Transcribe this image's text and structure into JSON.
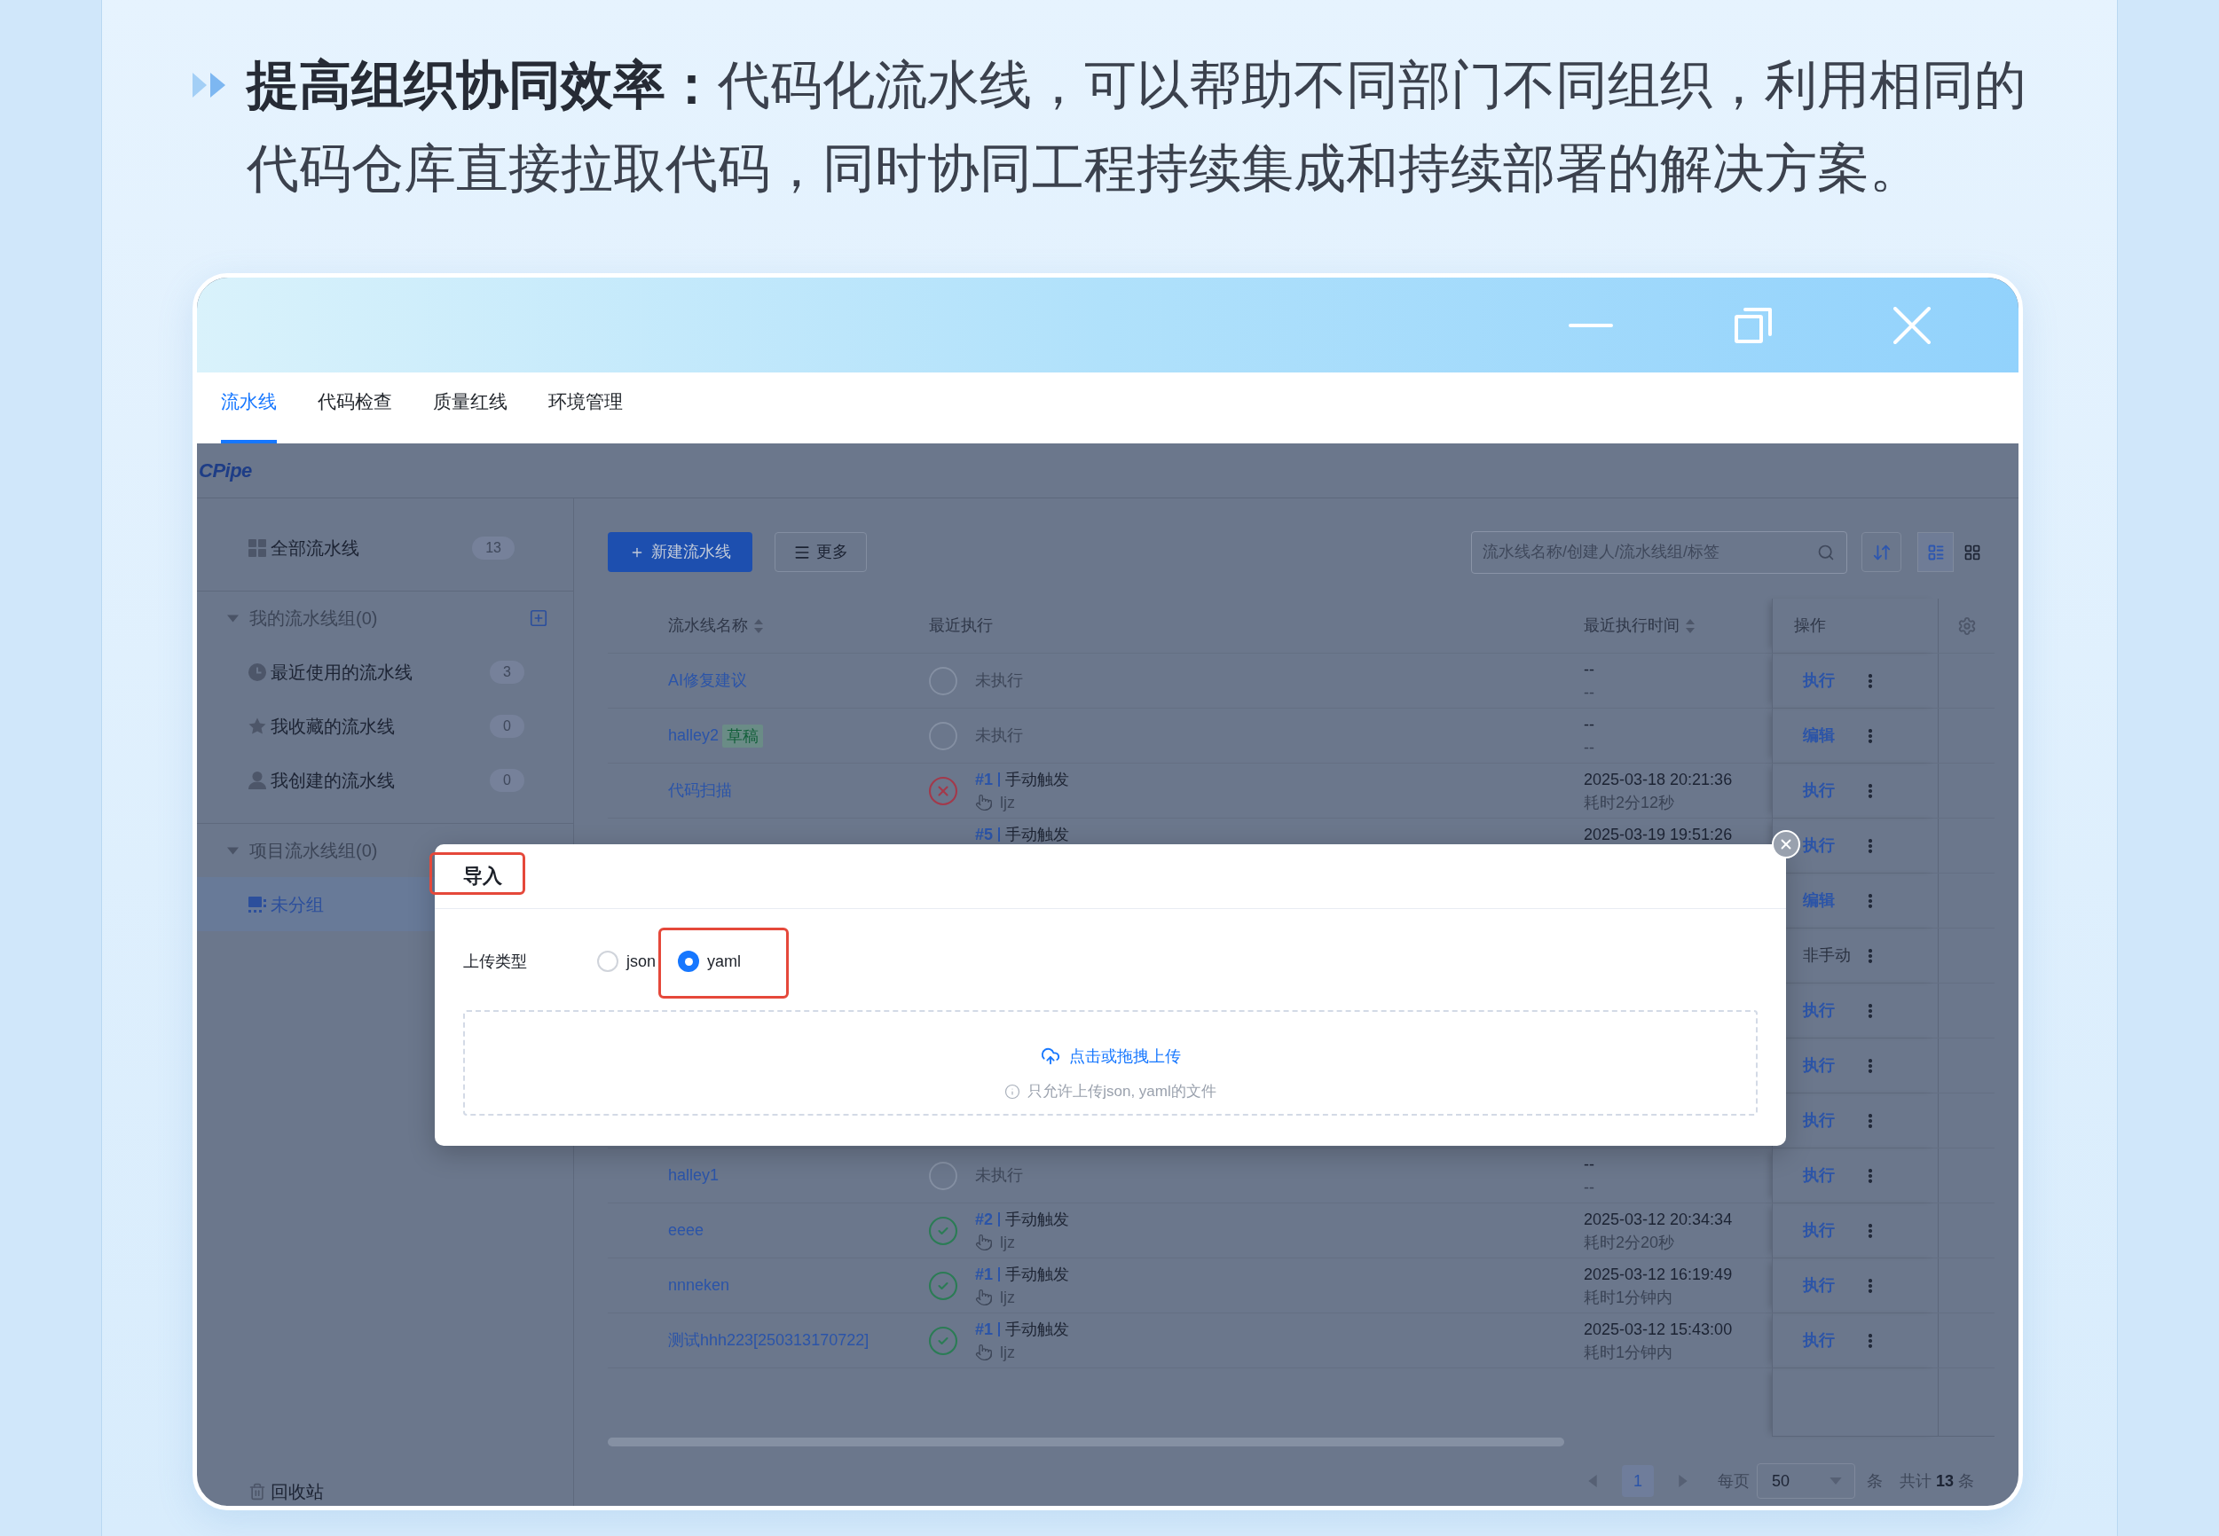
{
  "heading": {
    "text": "**提高组织协同效率：**代码化流水线，可以帮助不同部门不同组织，利用相同的代码仓库直接拉取代码，同时协同工程持续集成和持续部署的解决方案。"
  },
  "tabs": [
    {
      "label": "流水线",
      "selected": true
    },
    {
      "label": "代码检查",
      "selected": false
    },
    {
      "label": "质量红线",
      "selected": false
    },
    {
      "label": "环境管理",
      "selected": false
    }
  ],
  "app": {
    "logo": "CPipe"
  },
  "sidebar": {
    "all": {
      "label": "全部流水线",
      "count": "13",
      "selected": false
    },
    "groups": [
      {
        "title": "我的流水线组(0)",
        "expanded": true,
        "can_add": true,
        "items": [
          {
            "kind": "recent",
            "label": "最近使用的流水线",
            "count": "3",
            "selected": false
          },
          {
            "kind": "favorites",
            "label": "我收藏的流水线",
            "count": "0",
            "selected": false
          },
          {
            "kind": "created",
            "label": "我创建的流水线",
            "count": "0",
            "selected": false
          }
        ]
      },
      {
        "title": "项目流水线组(0)",
        "expanded": true,
        "can_add": false,
        "items": [
          {
            "kind": "ungrouped",
            "label": "未分组",
            "selected": true
          }
        ]
      }
    ],
    "footer": {
      "label": "回收站"
    }
  },
  "toolbar": {
    "new_button": "新建流水线",
    "more_button": "更多",
    "search": {
      "placeholder": "流水线名称/创建人/流水线组/标签"
    },
    "views": [
      {
        "kind": "list",
        "selected": true
      },
      {
        "kind": "grid",
        "selected": false
      }
    ]
  },
  "table": {
    "columns": [
      {
        "label": "流水线名称",
        "sortable": true
      },
      {
        "label": "最近执行",
        "sortable": false
      },
      {
        "label": "最近执行时间",
        "sortable": true
      },
      {
        "label": "操作",
        "sortable": false
      }
    ],
    "rows": [
      {
        "name": "AI修复建议",
        "run": {
          "kind": "idle",
          "label": "未执行"
        },
        "time": {
          "date": "--",
          "duration": "--"
        },
        "action": {
          "label": "执行",
          "disabled": false
        }
      },
      {
        "name": "halley2",
        "tag": "草稿",
        "run": {
          "kind": "idle",
          "label": "未执行"
        },
        "time": {
          "date": "--",
          "duration": "--"
        },
        "action": {
          "label": "编辑",
          "disabled": false
        }
      },
      {
        "name": "代码扫描",
        "run": {
          "kind": "failed",
          "number": "#1",
          "trigger": "手动触发",
          "user": "ljz"
        },
        "time": {
          "date": "2025-03-18 20:21:36",
          "duration": "耗时2分12秒"
        },
        "action": {
          "label": "执行",
          "disabled": false
        }
      },
      {
        "run": {
          "number": "#5",
          "trigger": "手动触发"
        },
        "time": {
          "date": "2025-03-19 19:51:26"
        },
        "action": {
          "label": "执行",
          "disabled": false
        }
      },
      {
        "action": {
          "label": "编辑",
          "disabled": false
        }
      },
      {
        "action": {
          "label": "非手动",
          "disabled": true
        }
      },
      {
        "action": {
          "label": "执行",
          "disabled": false
        }
      },
      {
        "action": {
          "label": "执行",
          "disabled": false
        }
      },
      {
        "action": {
          "label": "执行",
          "disabled": false
        }
      },
      {
        "name": "halley1",
        "run": {
          "kind": "idle",
          "label": "未执行"
        },
        "time": {
          "date": "--",
          "duration": "--"
        },
        "action": {
          "label": "执行",
          "disabled": false
        }
      },
      {
        "name": "eeee",
        "run": {
          "kind": "success",
          "number": "#2",
          "trigger": "手动触发",
          "user": "ljz"
        },
        "time": {
          "date": "2025-03-12 20:34:34",
          "duration": "耗时2分20秒"
        },
        "action": {
          "label": "执行",
          "disabled": false
        }
      },
      {
        "name": "nnneken",
        "run": {
          "kind": "success",
          "number": "#1",
          "trigger": "手动触发",
          "user": "ljz"
        },
        "time": {
          "date": "2025-03-12 16:19:49",
          "duration": "耗时1分钟内"
        },
        "action": {
          "label": "执行",
          "disabled": false
        }
      },
      {
        "name": "测试hhh223[250313170722]",
        "run": {
          "kind": "success",
          "number": "#1",
          "trigger": "手动触发",
          "user": "ljz"
        },
        "time": {
          "date": "2025-03-12 15:43:00",
          "duration": "耗时1分钟内"
        },
        "action": {
          "label": "执行",
          "disabled": false
        }
      }
    ]
  },
  "pagination": {
    "pages": [
      {
        "label": "1",
        "selected": true
      }
    ],
    "per_page_label": "每页",
    "page_size": "50",
    "page_size_unit": "条",
    "total": "共计 **13** 条"
  },
  "modal": {
    "title": {
      "text": "导入",
      "highlighted": true
    },
    "field_label": "上传类型",
    "options": [
      {
        "label": "json",
        "selected": false,
        "highlighted": false
      },
      {
        "label": "yaml",
        "selected": true,
        "highlighted": true
      }
    ],
    "upload": {
      "action": "点击或拖拽上传",
      "hint": "只允许上传json, yaml的文件"
    }
  }
}
